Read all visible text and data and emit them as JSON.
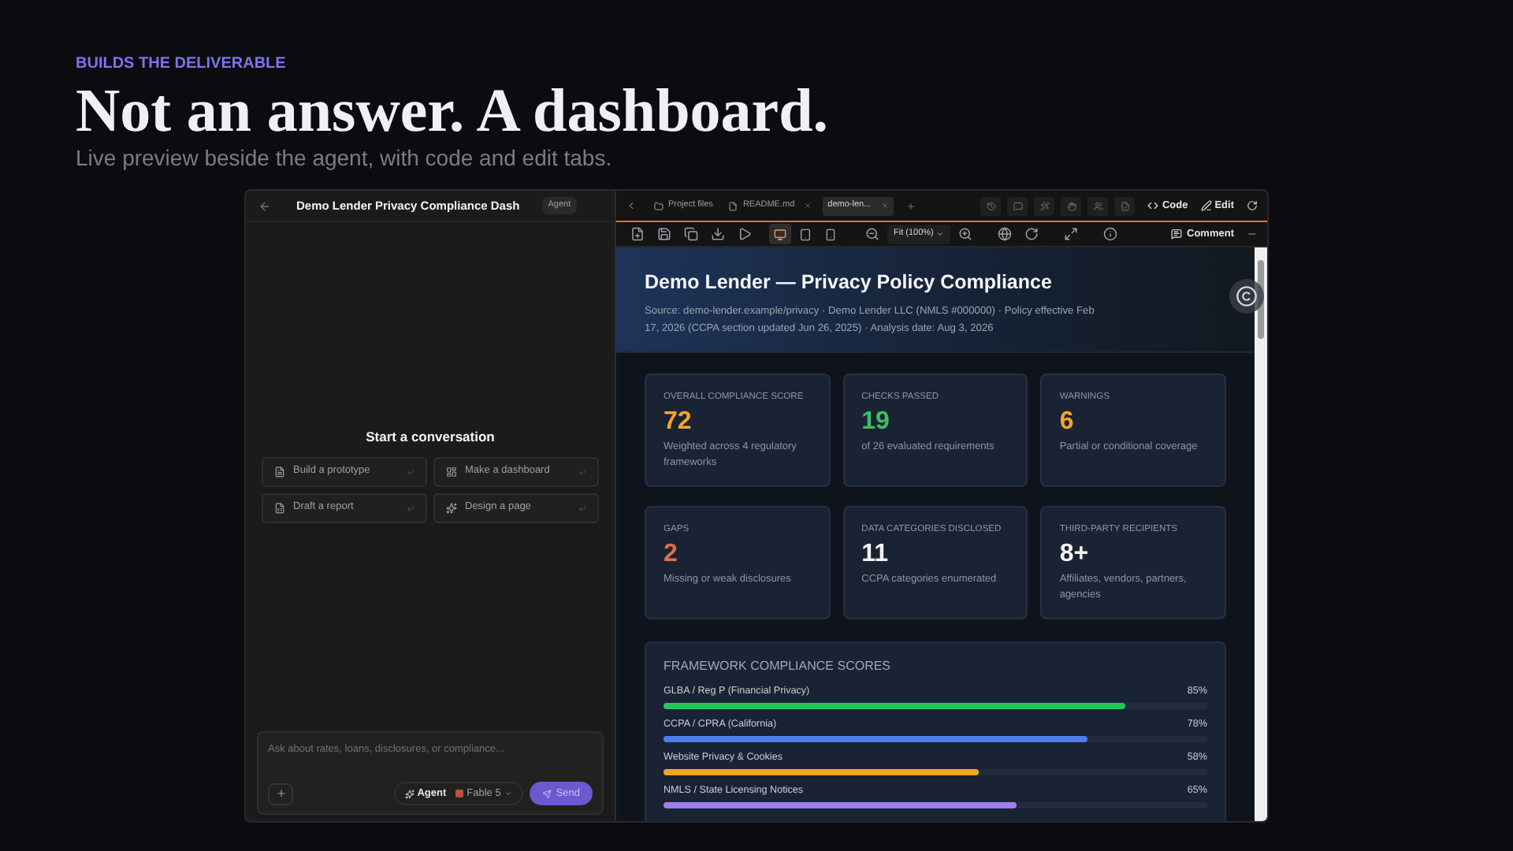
{
  "eyebrow": "BUILDS THE DELIVERABLE",
  "headline": "Not an answer. A dashboard.",
  "subhead": "Live preview beside the agent, with code and edit tabs.",
  "chat": {
    "title": "Demo Lender Privacy Compliance Dash",
    "badge": "Agent",
    "empty_title": "Start a conversation",
    "suggestions": [
      {
        "kind": "prototype",
        "label": "Build a prototype"
      },
      {
        "kind": "dashboard",
        "label": "Make a dashboard"
      },
      {
        "kind": "report",
        "label": "Draft a report"
      },
      {
        "kind": "design",
        "label": "Design a page"
      }
    ],
    "input": {
      "placeholder": "Ask about rates, loans, disclosures, or compliance..."
    },
    "mode": "Agent",
    "model": "Fable 5",
    "send": "Send"
  },
  "editor": {
    "tabs": [
      {
        "kind": "folder",
        "label": "Project files",
        "selected": false
      },
      {
        "kind": "file",
        "label": "README.md",
        "selected": false
      },
      {
        "kind": "file",
        "label": "demo-len...",
        "selected": true
      }
    ],
    "code_button": "Code",
    "edit_button": "Edit",
    "view_modes": [
      {
        "kind": "desktop",
        "selected": true
      },
      {
        "kind": "tablet",
        "selected": false
      },
      {
        "kind": "phone",
        "selected": false
      }
    ],
    "zoom": "Fit (100%)",
    "comment": "Comment"
  },
  "report": {
    "title": "Demo Lender — Privacy Policy Compliance",
    "meta": "Source: demo-lender.example/privacy  ·  Demo Lender LLC (NMLS #000000)  ·  Policy effective Feb 17, 2026 (CCPA section updated Jun 26, 2025)  ·  Analysis date: Aug 3, 2026",
    "stats": [
      {
        "label": "OVERALL COMPLIANCE SCORE",
        "value": "72",
        "color": "#f5a524",
        "note": "Weighted across 4 regulatory frameworks"
      },
      {
        "label": "CHECKS PASSED",
        "value": "19",
        "color": "#3fbf64",
        "note": "of 26 evaluated requirements"
      },
      {
        "label": "WARNINGS",
        "value": "6",
        "color": "#f5a524",
        "note": "Partial or conditional coverage"
      },
      {
        "label": "GAPS",
        "value": "2",
        "color": "#e06c4c",
        "note": "Missing or weak disclosures"
      },
      {
        "label": "DATA CATEGORIES DISCLOSED",
        "value": "11",
        "color": "#f4f4f5",
        "note": "CCPA categories enumerated"
      },
      {
        "label": "THIRD-PARTY RECIPIENTS",
        "value": "8+",
        "color": "#f4f4f5",
        "note": "Affiliates, vendors, partners, agencies"
      }
    ],
    "frameworks_title": "FRAMEWORK COMPLIANCE SCORES",
    "frameworks": [
      {
        "name": "GLBA / Reg P (Financial Privacy)",
        "reading": "85%",
        "level": 0.85,
        "color": "#22c55e"
      },
      {
        "name": "CCPA / CPRA (California)",
        "reading": "78%",
        "level": 0.78,
        "color": "#4f7cf0"
      },
      {
        "name": "Website Privacy & Cookies",
        "reading": "58%",
        "level": 0.58,
        "color": "#f5a524"
      },
      {
        "name": "NMLS / State Licensing Notices",
        "reading": "65%",
        "level": 0.65,
        "color": "#9f7ff0"
      }
    ]
  }
}
